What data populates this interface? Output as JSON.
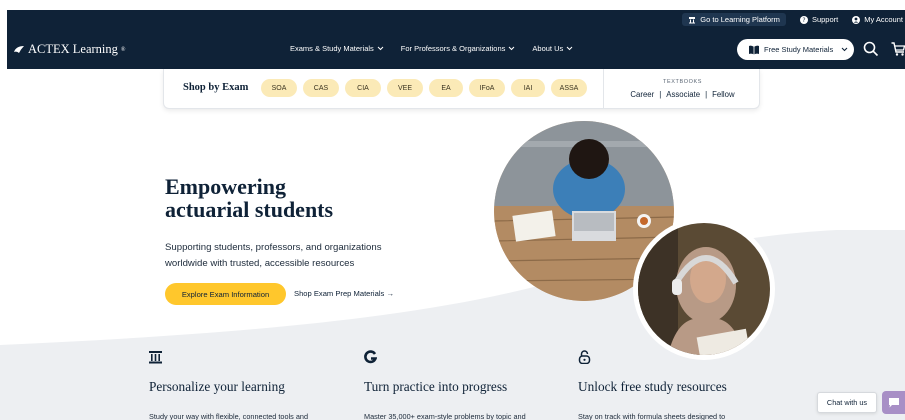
{
  "utility_nav": [
    {
      "label": "Go to Learning Platform",
      "icon": "platform-icon"
    },
    {
      "label": "Support",
      "icon": "help-icon"
    },
    {
      "label": "My Account",
      "icon": "account-icon"
    }
  ],
  "brand": {
    "name": "ACTEX Learning",
    "trademark": "®"
  },
  "main_nav": [
    {
      "label": "Exams & Study Materials"
    },
    {
      "label": "For Professors & Organizations"
    },
    {
      "label": "About Us"
    }
  ],
  "free_materials_button": "Free Study Materials",
  "shop": {
    "title": "Shop by Exam",
    "exams": [
      "SOA",
      "CAS",
      "CIA",
      "VEE",
      "EA",
      "IFoA",
      "IAI",
      "ASSA"
    ],
    "textbooks_label": "TEXTBOOKS",
    "textbook_levels": [
      "Career",
      "Associate",
      "Fellow"
    ]
  },
  "hero": {
    "title_line1": "Empowering",
    "title_line2": "actuarial students",
    "subtitle": "Supporting students, professors, and organizations worldwide with trusted, accessible resources",
    "cta_primary": "Explore Exam Information",
    "cta_secondary": "Shop Exam Prep Materials",
    "cta_secondary_arrow": "→"
  },
  "features": [
    {
      "icon": "column-icon",
      "title": "Personalize your learning",
      "text": "Study your way with flexible, connected tools and"
    },
    {
      "icon": "progress-g-icon",
      "title": "Turn practice into progress",
      "text": "Master 35,000+ exam-style problems by topic and"
    },
    {
      "icon": "unlock-icon",
      "title": "Unlock free study resources",
      "text": "Stay on track with formula sheets designed to"
    }
  ],
  "chat": {
    "label": "Chat with us",
    "icon": "chat-icon"
  },
  "colors": {
    "header": "#0f2237",
    "accent": "#ffc72c",
    "chip": "#fbeab7",
    "chat": "#a88fc6",
    "wave": "#edeff2"
  }
}
